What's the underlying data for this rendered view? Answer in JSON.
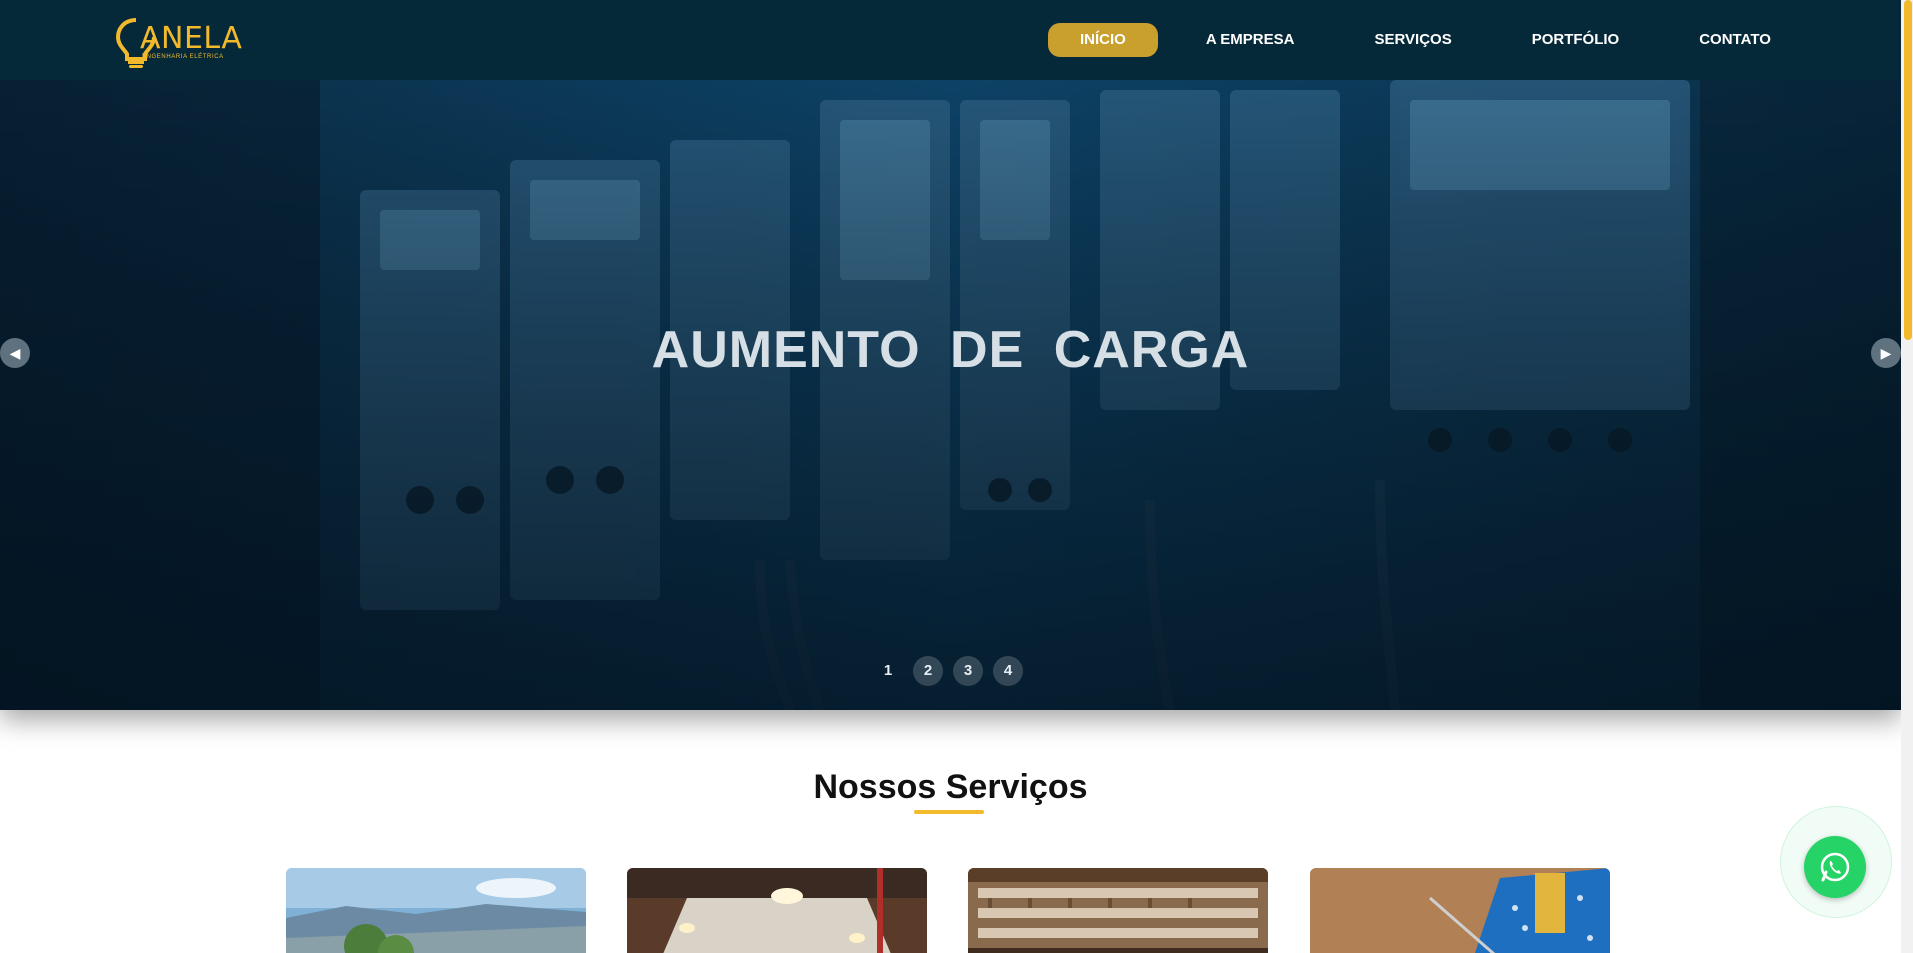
{
  "brand": {
    "logo_text": "ANELA",
    "logo_sub": "ENGENHARIA ELÉTRICA",
    "accent": "#c9a02e",
    "header_bg": "#06293a"
  },
  "nav": {
    "items": [
      {
        "label": "INÍCIO",
        "active": true
      },
      {
        "label": "A EMPRESA",
        "active": false
      },
      {
        "label": "SERVIÇOS",
        "active": false
      },
      {
        "label": "PORTFÓLIO",
        "active": false
      },
      {
        "label": "CONTATO",
        "active": false
      }
    ]
  },
  "hero": {
    "title": "AUMENTO DE CARGA",
    "prev_icon": "◀",
    "next_icon": "▶",
    "slides": [
      "1",
      "2",
      "3",
      "4"
    ],
    "active_slide": 1
  },
  "services": {
    "title": "Nossos Serviços"
  },
  "whatsapp": {
    "icon": "whatsapp-icon",
    "color": "#25d366"
  }
}
